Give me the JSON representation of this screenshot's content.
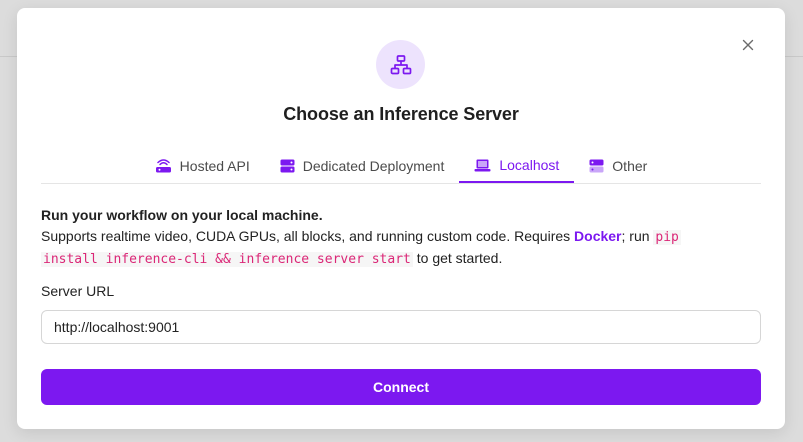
{
  "dialog": {
    "title": "Choose an Inference Server",
    "header_icon": "server-network-icon",
    "close_icon": "close-icon"
  },
  "tabs": [
    {
      "label": "Hosted API",
      "icon": "router-icon",
      "active": false
    },
    {
      "label": "Dedicated Deployment",
      "icon": "server-icon",
      "active": false
    },
    {
      "label": "Localhost",
      "icon": "laptop-icon",
      "active": true
    },
    {
      "label": "Other",
      "icon": "server-stack-icon",
      "active": false
    }
  ],
  "description": {
    "heading": "Run your workflow on your local machine.",
    "text_before_link": "Supports realtime video, CUDA GPUs, all blocks, and running custom code. Requires ",
    "link": "Docker",
    "text_after_link": "; run ",
    "command_part1": "pip",
    "command_part2": "install inference-cli && inference server start",
    "text_end": " to get started."
  },
  "server_url": {
    "label": "Server URL",
    "value": "http://localhost:9001"
  },
  "connect_label": "Connect",
  "colors": {
    "accent": "#7c18f0",
    "code": "#db2777",
    "icon_bg": "#ede3fd"
  }
}
